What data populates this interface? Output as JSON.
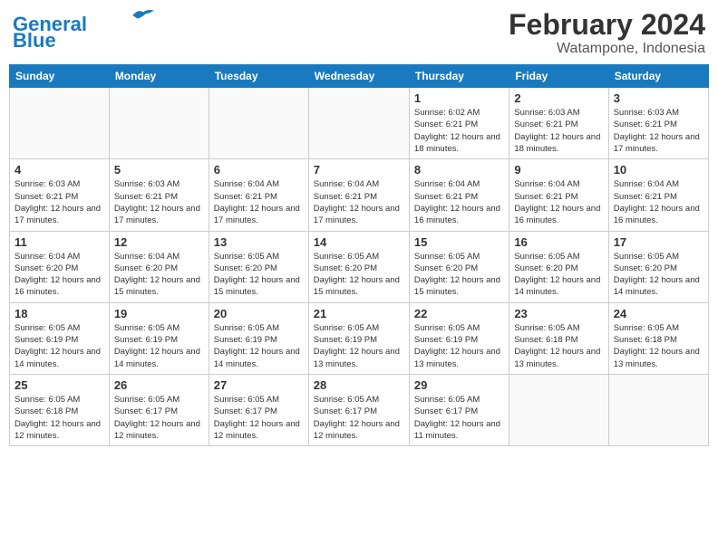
{
  "header": {
    "logo_line1": "General",
    "logo_line2": "Blue",
    "month": "February 2024",
    "location": "Watampone, Indonesia"
  },
  "days_of_week": [
    "Sunday",
    "Monday",
    "Tuesday",
    "Wednesday",
    "Thursday",
    "Friday",
    "Saturday"
  ],
  "weeks": [
    [
      {
        "num": "",
        "info": ""
      },
      {
        "num": "",
        "info": ""
      },
      {
        "num": "",
        "info": ""
      },
      {
        "num": "",
        "info": ""
      },
      {
        "num": "1",
        "info": "Sunrise: 6:02 AM\nSunset: 6:21 PM\nDaylight: 12 hours and 18 minutes."
      },
      {
        "num": "2",
        "info": "Sunrise: 6:03 AM\nSunset: 6:21 PM\nDaylight: 12 hours and 18 minutes."
      },
      {
        "num": "3",
        "info": "Sunrise: 6:03 AM\nSunset: 6:21 PM\nDaylight: 12 hours and 17 minutes."
      }
    ],
    [
      {
        "num": "4",
        "info": "Sunrise: 6:03 AM\nSunset: 6:21 PM\nDaylight: 12 hours and 17 minutes."
      },
      {
        "num": "5",
        "info": "Sunrise: 6:03 AM\nSunset: 6:21 PM\nDaylight: 12 hours and 17 minutes."
      },
      {
        "num": "6",
        "info": "Sunrise: 6:04 AM\nSunset: 6:21 PM\nDaylight: 12 hours and 17 minutes."
      },
      {
        "num": "7",
        "info": "Sunrise: 6:04 AM\nSunset: 6:21 PM\nDaylight: 12 hours and 17 minutes."
      },
      {
        "num": "8",
        "info": "Sunrise: 6:04 AM\nSunset: 6:21 PM\nDaylight: 12 hours and 16 minutes."
      },
      {
        "num": "9",
        "info": "Sunrise: 6:04 AM\nSunset: 6:21 PM\nDaylight: 12 hours and 16 minutes."
      },
      {
        "num": "10",
        "info": "Sunrise: 6:04 AM\nSunset: 6:21 PM\nDaylight: 12 hours and 16 minutes."
      }
    ],
    [
      {
        "num": "11",
        "info": "Sunrise: 6:04 AM\nSunset: 6:20 PM\nDaylight: 12 hours and 16 minutes."
      },
      {
        "num": "12",
        "info": "Sunrise: 6:04 AM\nSunset: 6:20 PM\nDaylight: 12 hours and 15 minutes."
      },
      {
        "num": "13",
        "info": "Sunrise: 6:05 AM\nSunset: 6:20 PM\nDaylight: 12 hours and 15 minutes."
      },
      {
        "num": "14",
        "info": "Sunrise: 6:05 AM\nSunset: 6:20 PM\nDaylight: 12 hours and 15 minutes."
      },
      {
        "num": "15",
        "info": "Sunrise: 6:05 AM\nSunset: 6:20 PM\nDaylight: 12 hours and 15 minutes."
      },
      {
        "num": "16",
        "info": "Sunrise: 6:05 AM\nSunset: 6:20 PM\nDaylight: 12 hours and 14 minutes."
      },
      {
        "num": "17",
        "info": "Sunrise: 6:05 AM\nSunset: 6:20 PM\nDaylight: 12 hours and 14 minutes."
      }
    ],
    [
      {
        "num": "18",
        "info": "Sunrise: 6:05 AM\nSunset: 6:19 PM\nDaylight: 12 hours and 14 minutes."
      },
      {
        "num": "19",
        "info": "Sunrise: 6:05 AM\nSunset: 6:19 PM\nDaylight: 12 hours and 14 minutes."
      },
      {
        "num": "20",
        "info": "Sunrise: 6:05 AM\nSunset: 6:19 PM\nDaylight: 12 hours and 14 minutes."
      },
      {
        "num": "21",
        "info": "Sunrise: 6:05 AM\nSunset: 6:19 PM\nDaylight: 12 hours and 13 minutes."
      },
      {
        "num": "22",
        "info": "Sunrise: 6:05 AM\nSunset: 6:19 PM\nDaylight: 12 hours and 13 minutes."
      },
      {
        "num": "23",
        "info": "Sunrise: 6:05 AM\nSunset: 6:18 PM\nDaylight: 12 hours and 13 minutes."
      },
      {
        "num": "24",
        "info": "Sunrise: 6:05 AM\nSunset: 6:18 PM\nDaylight: 12 hours and 13 minutes."
      }
    ],
    [
      {
        "num": "25",
        "info": "Sunrise: 6:05 AM\nSunset: 6:18 PM\nDaylight: 12 hours and 12 minutes."
      },
      {
        "num": "26",
        "info": "Sunrise: 6:05 AM\nSunset: 6:17 PM\nDaylight: 12 hours and 12 minutes."
      },
      {
        "num": "27",
        "info": "Sunrise: 6:05 AM\nSunset: 6:17 PM\nDaylight: 12 hours and 12 minutes."
      },
      {
        "num": "28",
        "info": "Sunrise: 6:05 AM\nSunset: 6:17 PM\nDaylight: 12 hours and 12 minutes."
      },
      {
        "num": "29",
        "info": "Sunrise: 6:05 AM\nSunset: 6:17 PM\nDaylight: 12 hours and 11 minutes."
      },
      {
        "num": "",
        "info": ""
      },
      {
        "num": "",
        "info": ""
      }
    ]
  ]
}
